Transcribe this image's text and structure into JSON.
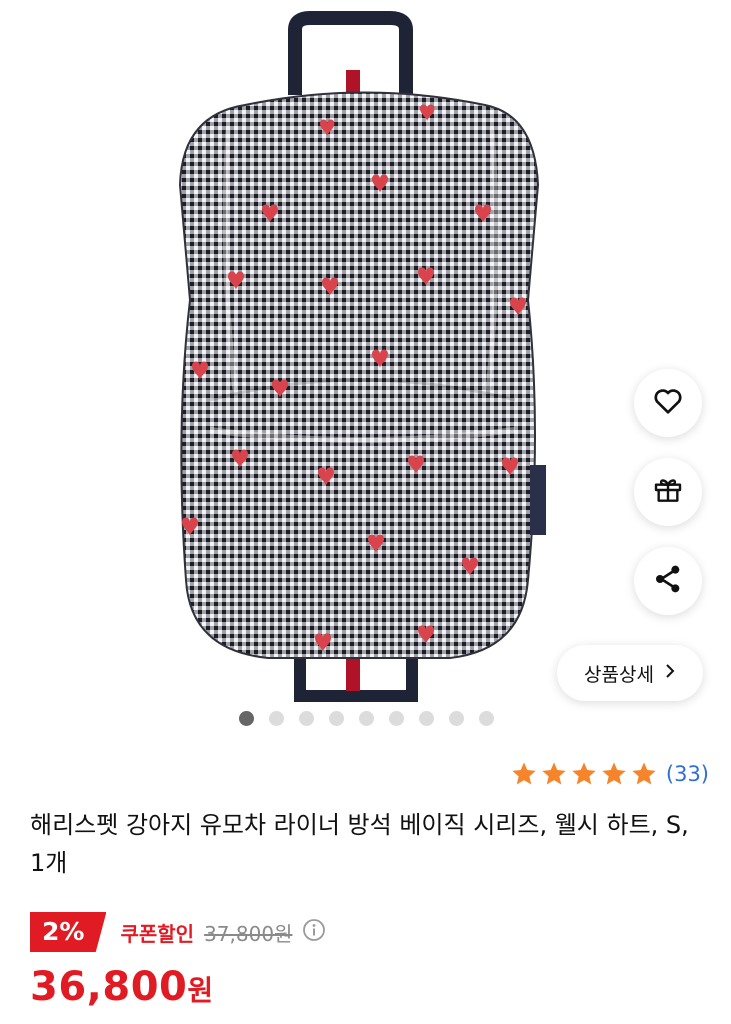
{
  "product": {
    "rating_count": "(33)",
    "rating_stars": 5,
    "title": "해리스펫 강아지 유모차 라이너 방석 베이직 시리즈, 웰시 하트, S, 1개",
    "discount_percent": "2%",
    "coupon_label": "쿠폰할인",
    "original_price": "37,800원",
    "final_price_number": "36,800",
    "final_price_unit": "원"
  },
  "gallery": {
    "total_images": 9,
    "active_index": 0
  },
  "actions": {
    "detail_label": "상품상세"
  },
  "icons": {
    "wishlist": "heart-icon",
    "gift": "gift-icon",
    "share": "share-icon",
    "detail_chevron": "chevron-right-icon",
    "info": "info-icon",
    "rating": "star-icon"
  },
  "colors": {
    "accent_red": "#e01b23",
    "rating_orange": "#f5842b",
    "link_blue": "#2f6fd6"
  }
}
